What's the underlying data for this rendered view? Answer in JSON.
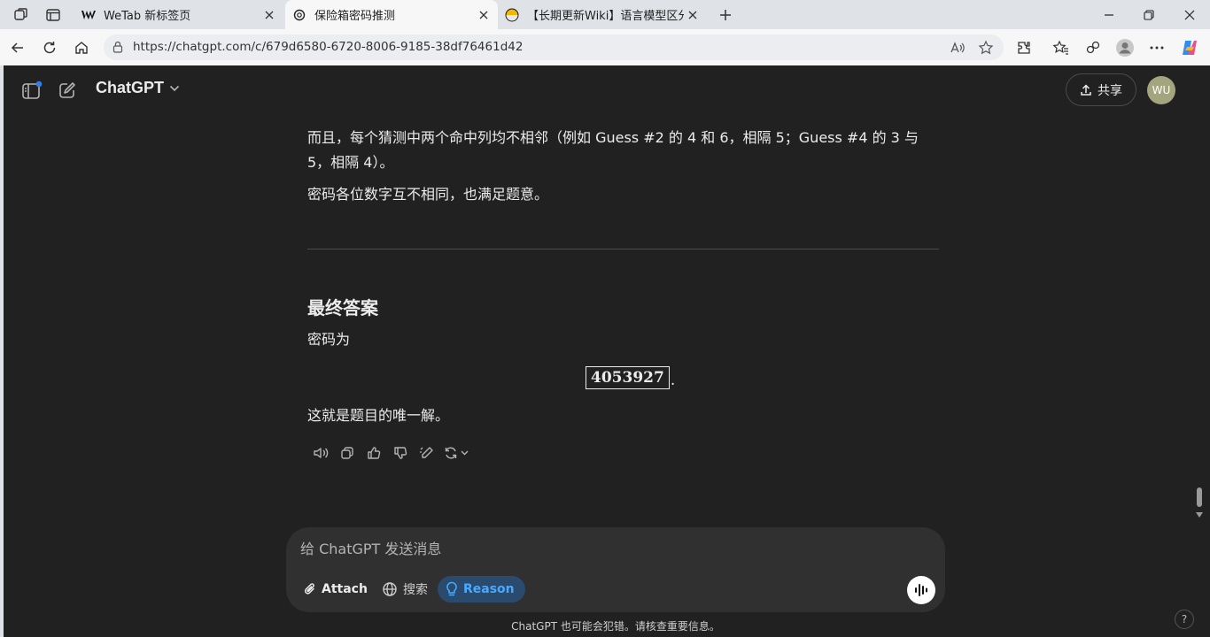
{
  "browser": {
    "tabs": [
      {
        "title": "WeTab 新标签页",
        "active": false
      },
      {
        "title": "保险箱密码推测",
        "active": true
      },
      {
        "title": "【长期更新Wiki】语言模型区分题",
        "active": false
      }
    ],
    "url": "https://chatgpt.com/c/679d6580-6720-8006-9185-38df76461d42",
    "accent": "#1a73e8"
  },
  "header": {
    "model": "ChatGPT",
    "share_label": "共享",
    "avatar_initials": "WU"
  },
  "message": {
    "para1": "而且，每个猜测中两个命中列均不相邻（例如 Guess #2 的 4 和 6，相隔 5；Guess #4 的 3 与 5，相隔 4）。",
    "para2": "密码各位数字互不相同，也满足题意。",
    "heading": "最终答案",
    "para3": "密码为",
    "answer": "4053927",
    "answer_suffix": ".",
    "para4": "这就是题目的唯一解。"
  },
  "composer": {
    "placeholder": "给 ChatGPT 发送消息",
    "attach_label": "Attach",
    "search_label": "搜索",
    "reason_label": "Reason"
  },
  "footer": {
    "disclaimer": "ChatGPT 也可能会犯错。请核查重要信息。",
    "help": "?"
  },
  "colors": {
    "page_bg": "#212121",
    "composer_bg": "#303030",
    "reason_bg": "#2a4a6e",
    "reason_fg": "#48aaff",
    "avatar_bg": "#a3a57e"
  }
}
